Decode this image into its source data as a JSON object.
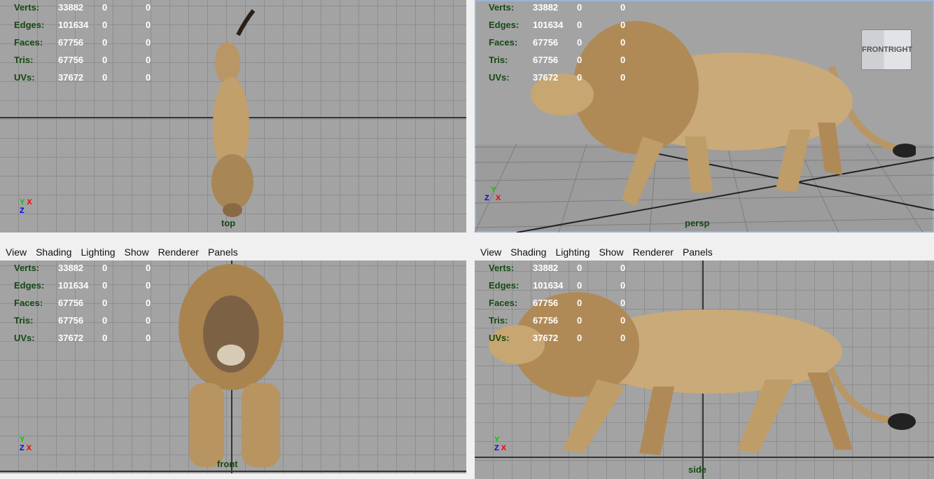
{
  "menu": [
    "View",
    "Shading",
    "Lighting",
    "Show",
    "Renderer",
    "Panels"
  ],
  "stats": [
    {
      "label": "Verts:",
      "value": "33882",
      "sel": "0",
      "comp": "0"
    },
    {
      "label": "Edges:",
      "value": "101634",
      "sel": "0",
      "comp": "0"
    },
    {
      "label": "Faces:",
      "value": "67756",
      "sel": "0",
      "comp": "0"
    },
    {
      "label": "Tris:",
      "value": "67756",
      "sel": "0",
      "comp": "0"
    },
    {
      "label": "UVs:",
      "value": "37672",
      "sel": "0",
      "comp": "0"
    }
  ],
  "viewports": {
    "top": {
      "camera": "top"
    },
    "persp": {
      "camera": "persp",
      "cube_front": "FRONT",
      "cube_right": "RIGHT"
    },
    "front": {
      "camera": "front"
    },
    "side": {
      "camera": "side"
    }
  },
  "axes": {
    "x": "X",
    "y": "Y",
    "z": "Z"
  }
}
